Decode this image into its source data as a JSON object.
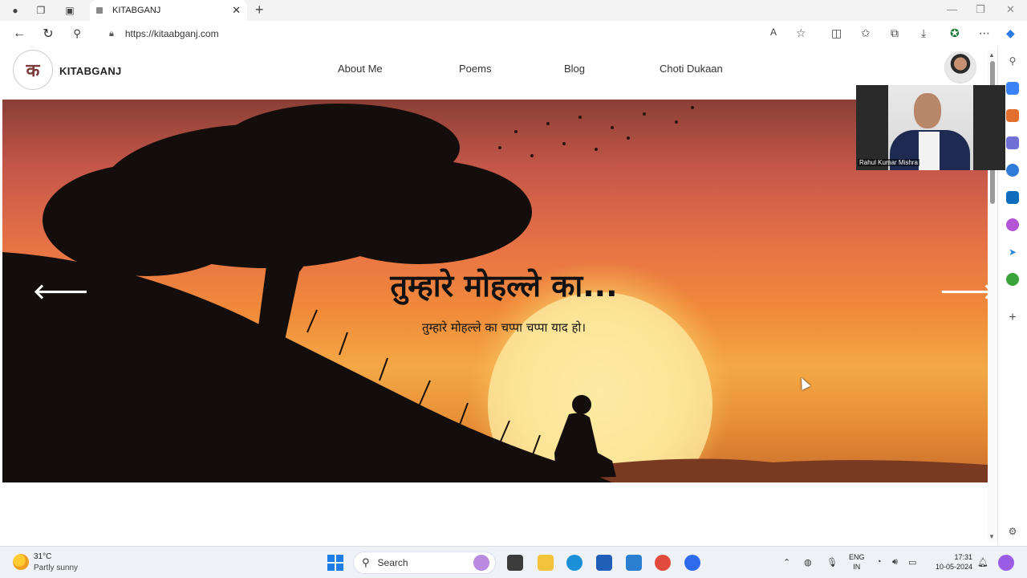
{
  "browser": {
    "tab_title": "KITABGANJ",
    "url": "https://kitaabganj.com"
  },
  "site": {
    "logo_glyph": "क",
    "brand": "KITABGANJ",
    "menu": [
      "About Me",
      "Poems",
      "Blog",
      "Choti Dukaan"
    ]
  },
  "hero": {
    "title": "तुम्हारे मोहल्ले का...",
    "subtitle": "तुम्हारे मोहल्ले का चप्पा चप्पा याद हो।",
    "prev_icon": "arrow-left-icon",
    "next_icon": "arrow-right-icon"
  },
  "video_call": {
    "participant_name": "Rahul Kumar Mishra"
  },
  "taskbar": {
    "weather_temp": "31°C",
    "weather_desc": "Partly sunny",
    "search_label": "Search",
    "lang_line1": "ENG",
    "lang_line2": "IN",
    "time": "17:31",
    "date": "10-05-2024"
  }
}
